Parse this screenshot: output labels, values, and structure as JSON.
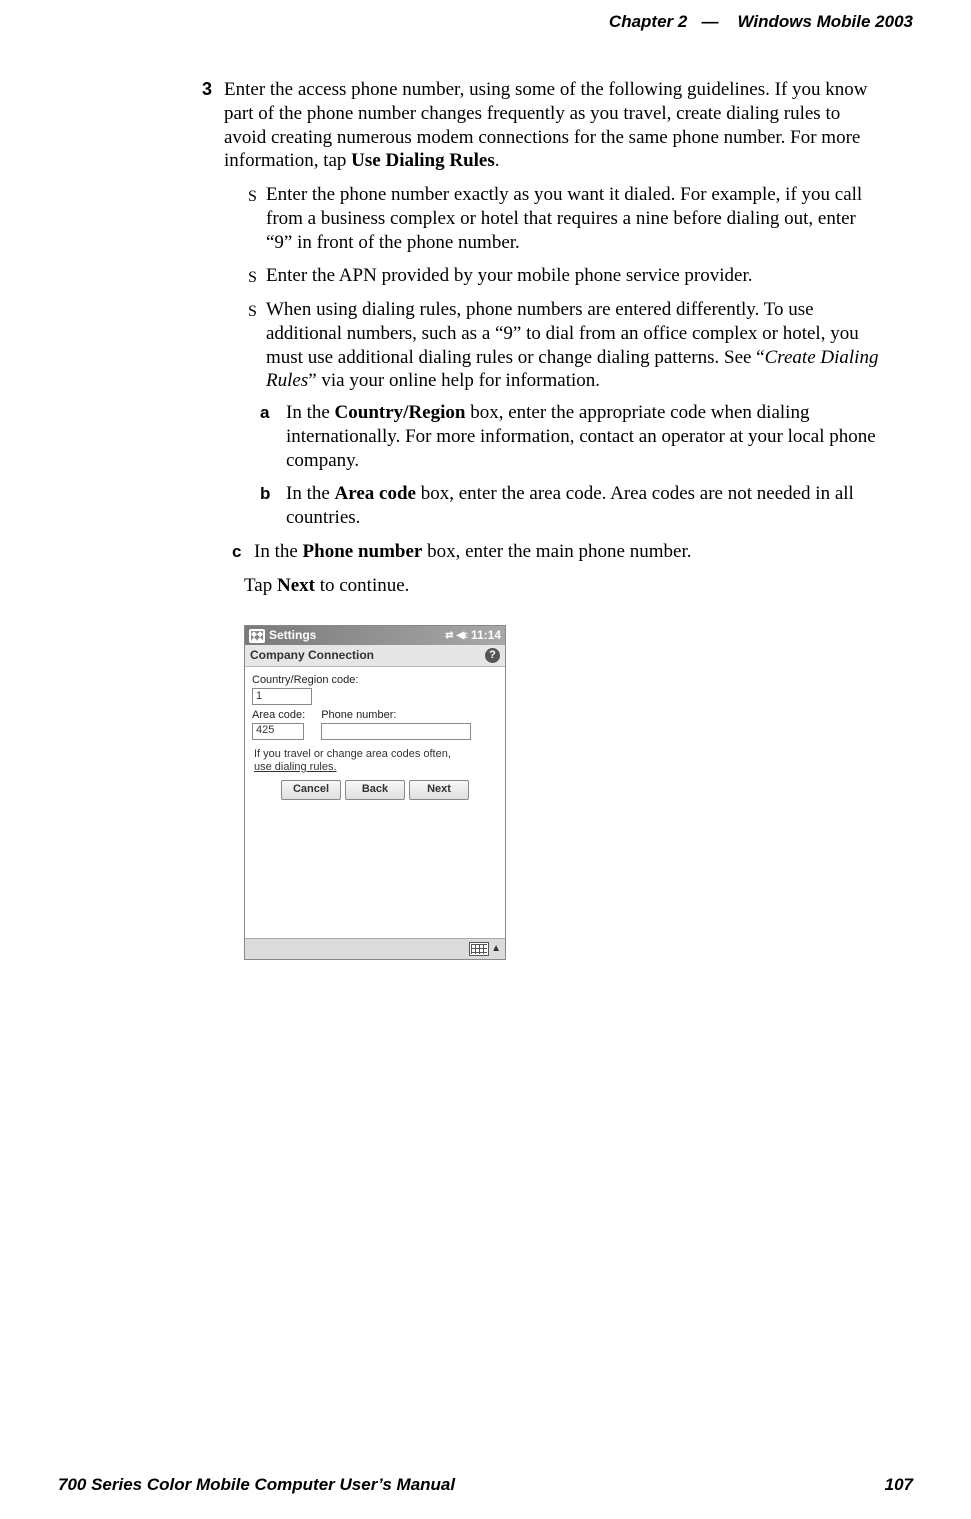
{
  "header": {
    "left": "Chapter",
    "chapnum": "2",
    "dash": "—",
    "right": "Windows Mobile 2003"
  },
  "step": {
    "num": "3",
    "p1a": "Enter the access phone number, using some of the following guidelines. If you know part of the phone number changes frequently as you travel, create dialing rules to avoid creating numerous modem connections for the same phone number. For more information, tap ",
    "p1b": "Use Dialing Rules",
    "p1c": ".",
    "b1": "Enter the phone number exactly as you want it dialed. For example, if you call from a business complex or hotel that requires a nine before dialing out, enter “9” in front of the phone number.",
    "b2": "Enter the APN provided by your mobile phone service provider.",
    "b3a": "When using dialing rules, phone numbers are entered differently. To use additional numbers, such as a “9” to dial from an office complex or hotel, you must use additional dialing rules or change dialing patterns. See “",
    "b3b": "Create Dialing Rules",
    "b3c": "” via your online help for information.",
    "a_lbl": "a",
    "a1": "In the ",
    "a2": "Country/Region",
    "a3": " box, enter the appropriate code when dialing internationally. For more information, contact an operator at your local phone company.",
    "b_lbl": "b",
    "bb1": "In the ",
    "bb2": "Area code",
    "bb3": " box, enter the area code. Area codes are not needed in all countries.",
    "c_lbl": "c",
    "c1": "In the ",
    "c2": "Phone number",
    "c3": " box, enter the main phone number.",
    "tap1": "Tap ",
    "tap2": "Next",
    "tap3": " to continue."
  },
  "pda": {
    "title": "Settings",
    "time": "11:14",
    "page_title": "Company Connection",
    "help": "?",
    "country_label": "Country/Region code:",
    "country_value": "1",
    "area_label": "Area code:",
    "area_value": "425",
    "phone_label": "Phone number:",
    "phone_value": "",
    "hint1": "If you travel or change area codes often,",
    "hint2": "use dialing rules.",
    "btn_cancel": "Cancel",
    "btn_back": "Back",
    "btn_next": "Next"
  },
  "footer": {
    "left": "700 Series Color Mobile Computer User’s Manual",
    "right": "107"
  }
}
